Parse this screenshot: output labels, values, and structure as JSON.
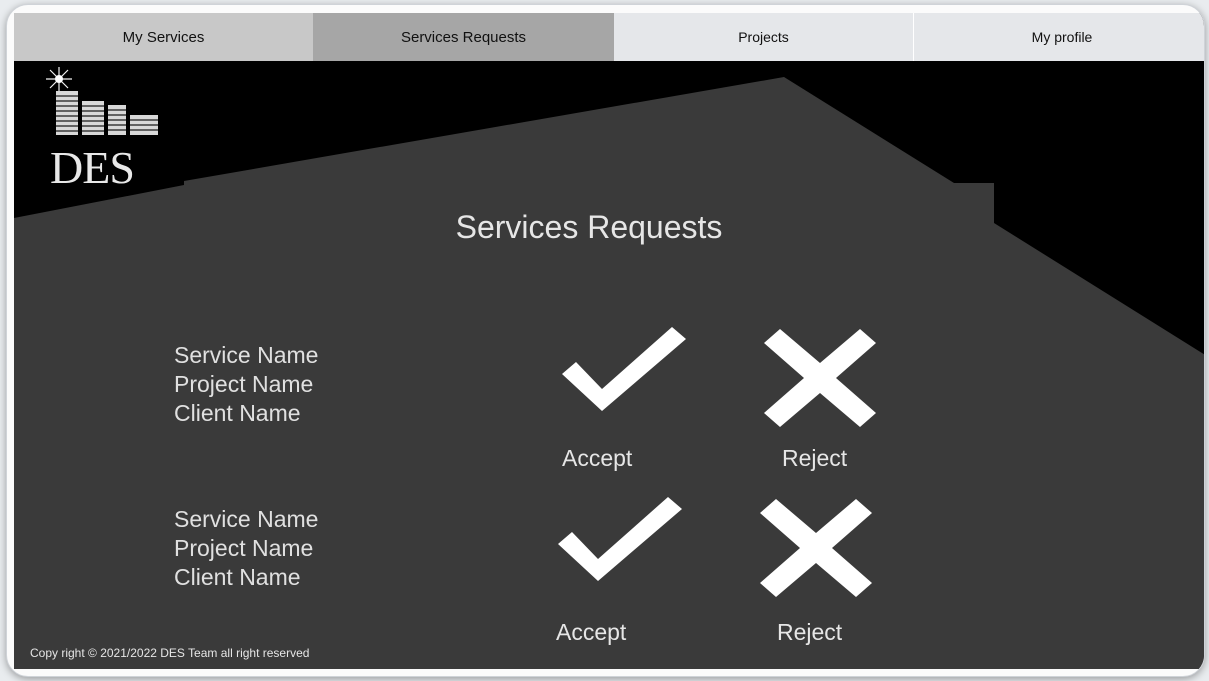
{
  "nav": {
    "tabs": [
      {
        "label": "My Services"
      },
      {
        "label": "Services Requests"
      },
      {
        "label": "Projects"
      },
      {
        "label": "My profile"
      }
    ]
  },
  "logo": {
    "text": "DES"
  },
  "page": {
    "title": "Services Requests"
  },
  "requests": [
    {
      "service": "Service Name",
      "project": "Project Name",
      "client": "Client Name",
      "accept_label": "Accept",
      "reject_label": "Reject"
    },
    {
      "service": "Service Name",
      "project": "Project Name",
      "client": "Client Name",
      "accept_label": "Accept",
      "reject_label": "Reject"
    }
  ],
  "footer": {
    "text": "Copy right © 2021/2022  DES Team all right reserved"
  },
  "icons": {
    "accept": "checkmark-icon",
    "reject": "x-icon",
    "logo": "buildings-icon"
  },
  "colors": {
    "background": "#000000",
    "panel": "#3a3a3a",
    "tab_active": "#a6a6a6",
    "tab_default": "#c8c8c8",
    "tab_light": "#e5e7ea"
  }
}
